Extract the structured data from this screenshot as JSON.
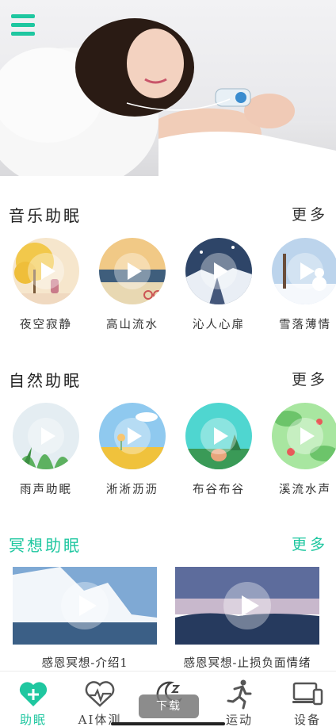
{
  "colors": {
    "accent": "#1fc7a0",
    "text": "#333333",
    "background": "#ffffff"
  },
  "banner": {
    "menu_icon": "hamburger-menu-icon",
    "dot_count": 3,
    "active_dot": 0
  },
  "music": {
    "title": "音乐助眠",
    "more": "更多",
    "items": [
      {
        "label": "夜空寂静",
        "icon": "play-icon"
      },
      {
        "label": "高山流水",
        "icon": "play-icon"
      },
      {
        "label": "沁人心扉",
        "icon": "play-icon"
      },
      {
        "label": "雪落薄情",
        "icon": "play-icon"
      }
    ]
  },
  "nature": {
    "title": "自然助眠",
    "more": "更多",
    "items": [
      {
        "label": "雨声助眠",
        "icon": "play-icon"
      },
      {
        "label": "淅淅沥沥",
        "icon": "play-icon"
      },
      {
        "label": "布谷布谷",
        "icon": "play-icon"
      },
      {
        "label": "溪流水声",
        "icon": "play-icon"
      }
    ]
  },
  "meditation": {
    "title": "冥想助眠",
    "more": "更多",
    "items": [
      {
        "label": "感恩冥想-介绍1"
      },
      {
        "label": "感恩冥想-止损负面情绪"
      }
    ]
  },
  "tabbar": {
    "tabs": [
      {
        "label": "助眠",
        "icon": "heart-plus-icon",
        "active": true
      },
      {
        "label": "AI体测",
        "icon": "heart-pulse-icon",
        "active": false
      },
      {
        "label": "",
        "icon": "moon-sleep-icon",
        "active": false
      },
      {
        "label": "运动",
        "icon": "running-icon",
        "active": false
      },
      {
        "label": "设备",
        "icon": "device-icon",
        "active": false
      }
    ]
  },
  "toast": {
    "text": "下载"
  }
}
